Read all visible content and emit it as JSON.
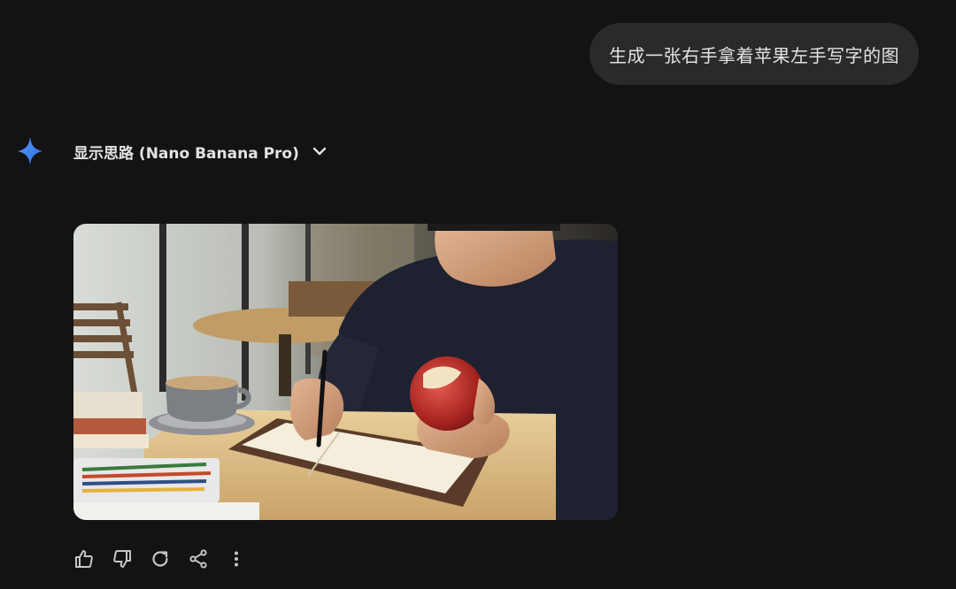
{
  "conversation": {
    "user_prompt": "生成一张右手拿着苹果左手写字的图",
    "model_response": {
      "thoughts_label": "显示思路 (Nano Banana Pro)",
      "icons": {
        "model": "sparkle-icon",
        "toggle": "chevron-down-icon"
      },
      "image": {
        "subject": "man eating apple while writing in notebook at cafe table"
      },
      "actions": [
        {
          "name": "thumbs-up",
          "icon": "thumbs-up-icon"
        },
        {
          "name": "thumbs-down",
          "icon": "thumbs-down-icon"
        },
        {
          "name": "regenerate",
          "icon": "refresh-icon"
        },
        {
          "name": "share",
          "icon": "share-icon"
        },
        {
          "name": "more-options",
          "icon": "more-vert-icon"
        }
      ]
    }
  },
  "colors": {
    "background": "#131314",
    "bubble": "#282a2c",
    "text": "#e3e3e3",
    "icon": "#c4c7c5",
    "accent_start": "#4e8df5",
    "accent_end": "#2f6fe4"
  }
}
